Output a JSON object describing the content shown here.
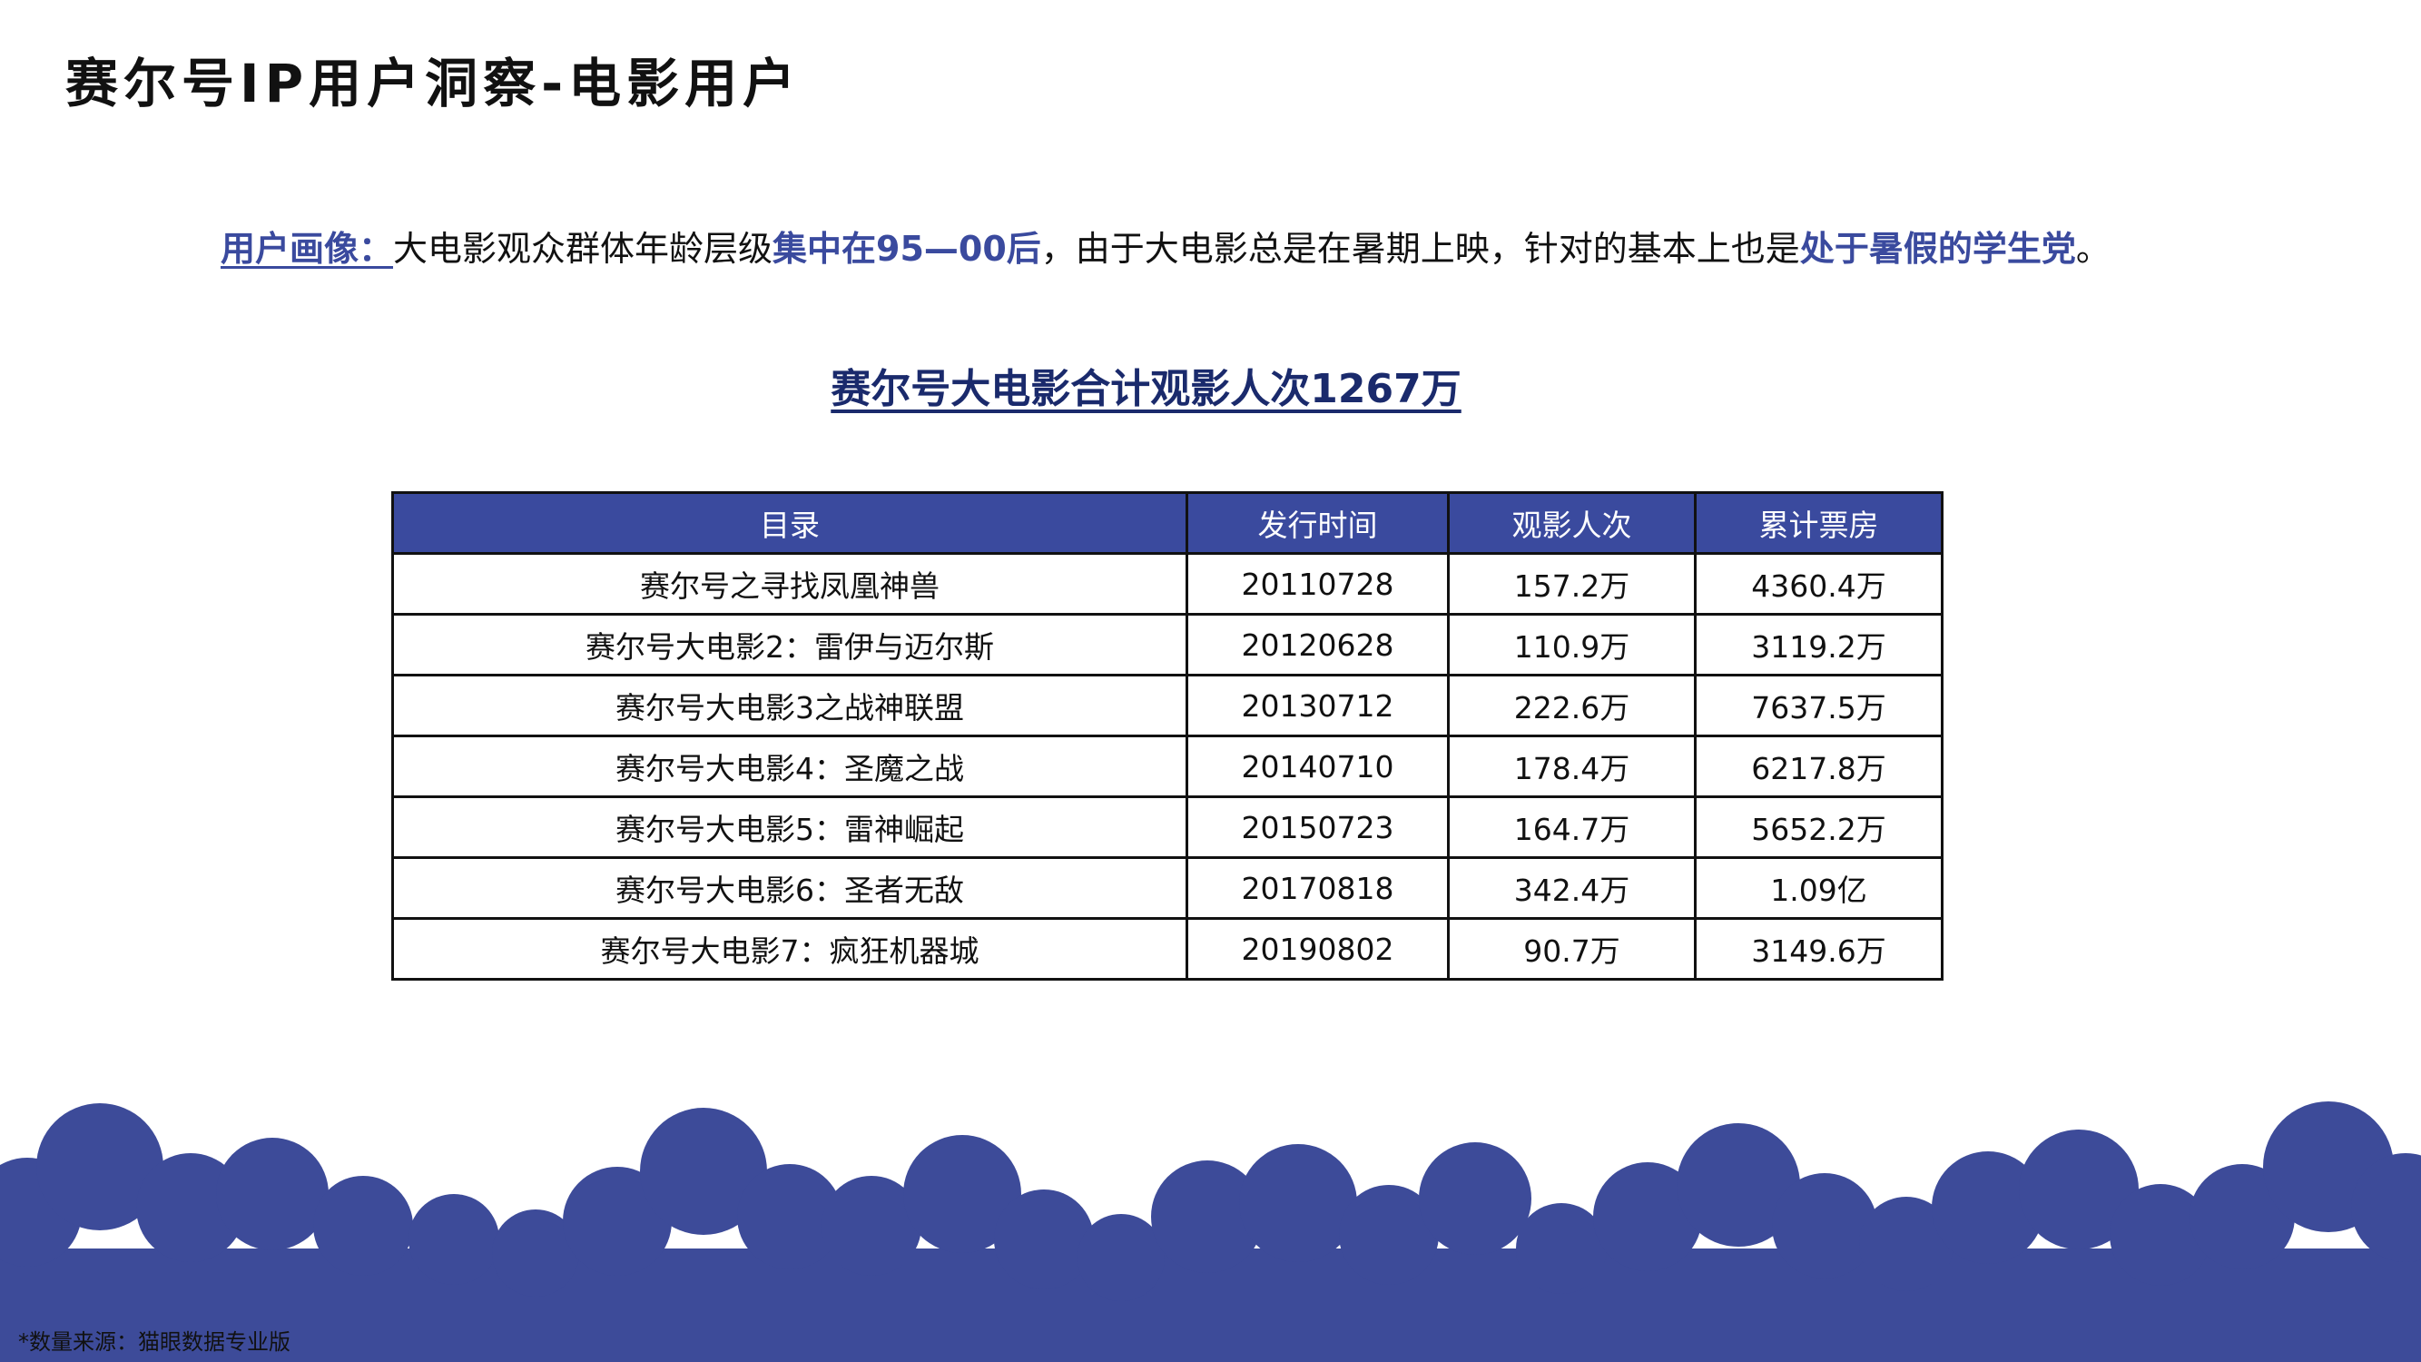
{
  "title": "赛尔号IP用户洞察-电影用户",
  "insight": {
    "label": "用户画像：",
    "text1": "大电影观众群体年龄层级",
    "highlight1": "集中在95—00后",
    "text2": "，由于大电影总是在暑期上映，针对的基本上也是",
    "highlight2": "处于暑假的学生党",
    "text3": "。"
  },
  "subtitle": "赛尔号大电影合计观影人次1267万",
  "table": {
    "headers": [
      "目录",
      "发行时间",
      "观影人次",
      "累计票房"
    ],
    "rows": [
      [
        "赛尔号之寻找凤凰神兽",
        "20110728",
        "157.2万",
        "4360.4万"
      ],
      [
        "赛尔号大电影2：雷伊与迈尔斯",
        "20120628",
        "110.9万",
        "3119.2万"
      ],
      [
        "赛尔号大电影3之战神联盟",
        "20130712",
        "222.6万",
        "7637.5万"
      ],
      [
        "赛尔号大电影4：圣魔之战",
        "20140710",
        "178.4万",
        "6217.8万"
      ],
      [
        "赛尔号大电影5：雷神崛起",
        "20150723",
        "164.7万",
        "5652.2万"
      ],
      [
        "赛尔号大电影6：圣者无敌",
        "20170818",
        "342.4万",
        "1.09亿"
      ],
      [
        "赛尔号大电影7：疯狂机器城",
        "20190802",
        "90.7万",
        "3149.6万"
      ]
    ]
  },
  "source": "*数量来源：猫眼数据专业版",
  "colors": {
    "accent": "#3a4a9e",
    "subtitle": "#1a2a6c",
    "cloud": "#3d4b99"
  }
}
